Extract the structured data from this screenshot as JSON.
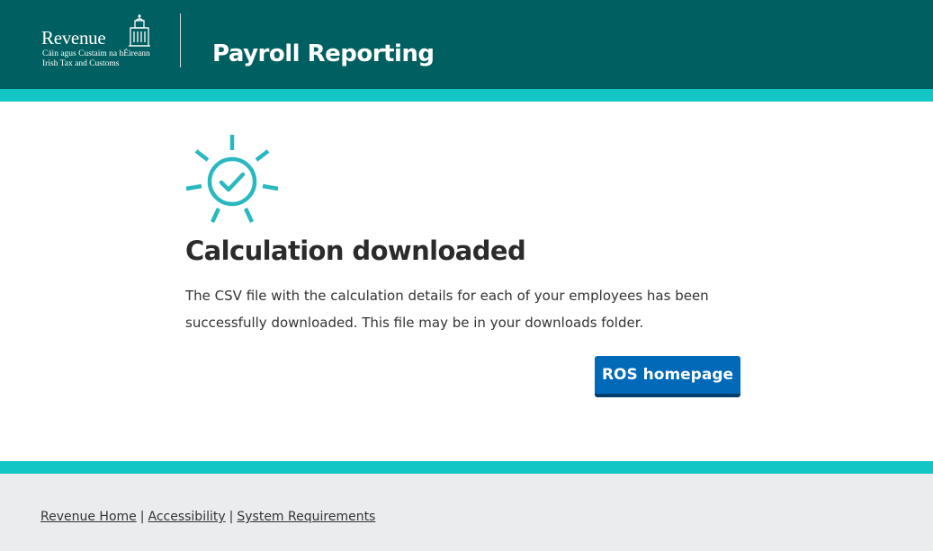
{
  "header": {
    "logo": {
      "name": "Revenue",
      "line1": "Cáin agus Custaim na hÉireann",
      "line2": "Irish Tax and Customs"
    },
    "title": "Payroll Reporting"
  },
  "main": {
    "icon": "success-sun-check-icon",
    "heading": "Calculation downloaded",
    "body": "The CSV file with the calculation details for each of your employees has been successfully downloaded. This file may be in your downloads folder.",
    "button_label": "ROS homepage"
  },
  "footer": {
    "links": [
      {
        "label": "Revenue Home"
      },
      {
        "label": "Accessibility"
      },
      {
        "label": "System Requirements"
      }
    ],
    "separator": "|"
  },
  "colors": {
    "header_bg": "#005f61",
    "accent_stripe": "#12c6c6",
    "icon": "#2ab8c0",
    "button": "#0069b8",
    "footer_bg": "#ebecee"
  }
}
